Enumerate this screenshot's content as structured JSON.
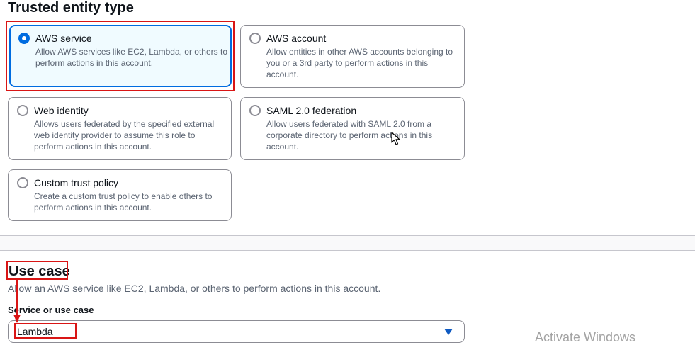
{
  "trusted_entity": {
    "title": "Trusted entity type",
    "options": [
      {
        "label": "AWS service",
        "description": "Allow AWS services like EC2, Lambda, or others to perform actions in this account.",
        "selected": true
      },
      {
        "label": "AWS account",
        "description": "Allow entities in other AWS accounts belonging to you or a 3rd party to perform actions in this account.",
        "selected": false
      },
      {
        "label": "Web identity",
        "description": "Allows users federated by the specified external web identity provider to assume this role to perform actions in this account.",
        "selected": false
      },
      {
        "label": "SAML 2.0 federation",
        "description": "Allow users federated with SAML 2.0 from a corporate directory to perform actions in this account.",
        "selected": false
      },
      {
        "label": "Custom trust policy",
        "description": "Create a custom trust policy to enable others to perform actions in this account.",
        "selected": false
      }
    ]
  },
  "use_case": {
    "title": "Use case",
    "description": "Allow an AWS service like EC2, Lambda, or others to perform actions in this account.",
    "field_label": "Service or use case",
    "selected_value": "Lambda"
  },
  "watermark": {
    "text": "Activate Windows"
  },
  "colors": {
    "accent": "#006ce0",
    "highlight": "#d91515",
    "selected_bg": "#f0fbff"
  },
  "icons": {
    "radio": "radio-button-icon",
    "dropdown": "caret-down-icon",
    "cursor": "mouse-pointer-icon"
  }
}
